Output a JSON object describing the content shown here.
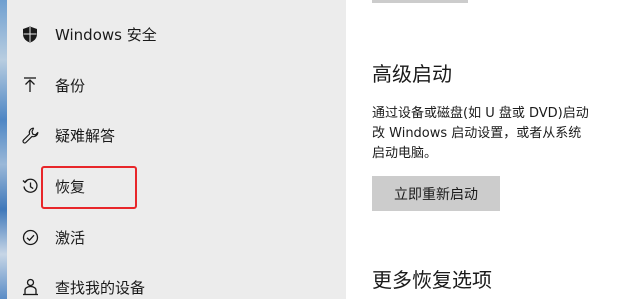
{
  "sidebar": {
    "items": [
      {
        "label": "Windows 安全",
        "icon": "shield-icon"
      },
      {
        "label": "备份",
        "icon": "backup-arrow-icon"
      },
      {
        "label": "疑难解答",
        "icon": "wrench-icon"
      },
      {
        "label": "恢复",
        "icon": "recovery-icon"
      },
      {
        "label": "激活",
        "icon": "check-circle-icon"
      },
      {
        "label": "查找我的设备",
        "icon": "person-location-icon"
      }
    ]
  },
  "main": {
    "advanced_startup": {
      "title": "高级启动",
      "description_lines": [
        "通过设备或磁盘(如 U 盘或 DVD)启动",
        "改 Windows 启动设置，或者从系统",
        "启动电脑。"
      ],
      "restart_button_label": "立即重新启动"
    },
    "more_recovery_title": "更多恢复选项"
  },
  "colors": {
    "sidebar_bg": "#ececec",
    "highlight_border": "#e8262a",
    "button_bg": "#cccccc",
    "text": "#1a1a1a"
  }
}
